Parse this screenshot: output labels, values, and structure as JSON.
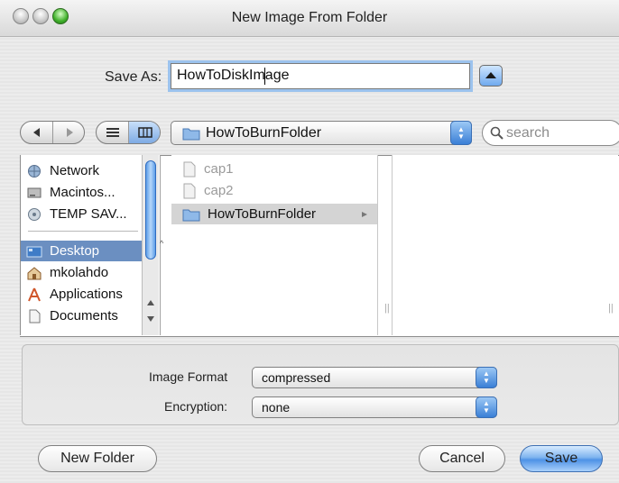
{
  "window": {
    "title": "New Image From Folder"
  },
  "save_as": {
    "label": "Save As:",
    "value": "HowToDiskImage"
  },
  "location_popup": {
    "value": "HowToBurnFolder"
  },
  "search": {
    "placeholder": "search"
  },
  "sidebar": {
    "items": [
      {
        "label": "Network",
        "icon": "network-icon"
      },
      {
        "label": "Macintos...",
        "icon": "hard-disk-icon"
      },
      {
        "label": "TEMP SAV...",
        "icon": "disk-icon"
      },
      {
        "label": "Desktop",
        "icon": "desktop-icon",
        "selected": true
      },
      {
        "label": "mkolahdo",
        "icon": "home-icon"
      },
      {
        "label": "Applications",
        "icon": "applications-icon"
      },
      {
        "label": "Documents",
        "icon": "documents-icon"
      }
    ]
  },
  "column1": {
    "items": [
      {
        "label": "cap1",
        "dimmed": true
      },
      {
        "label": "cap2",
        "dimmed": true
      },
      {
        "label": "HowToBurnFolder",
        "selected": true
      }
    ]
  },
  "options": {
    "image_format_label": "Image Format",
    "image_format_value": "compressed",
    "encryption_label": "Encryption:",
    "encryption_value": "none"
  },
  "buttons": {
    "new_folder": "New Folder",
    "cancel": "Cancel",
    "save": "Save"
  },
  "colors": {
    "selection": "#6b8fc1",
    "focus_ring": "#9cc3ee",
    "default_button": "#4e92e6"
  }
}
